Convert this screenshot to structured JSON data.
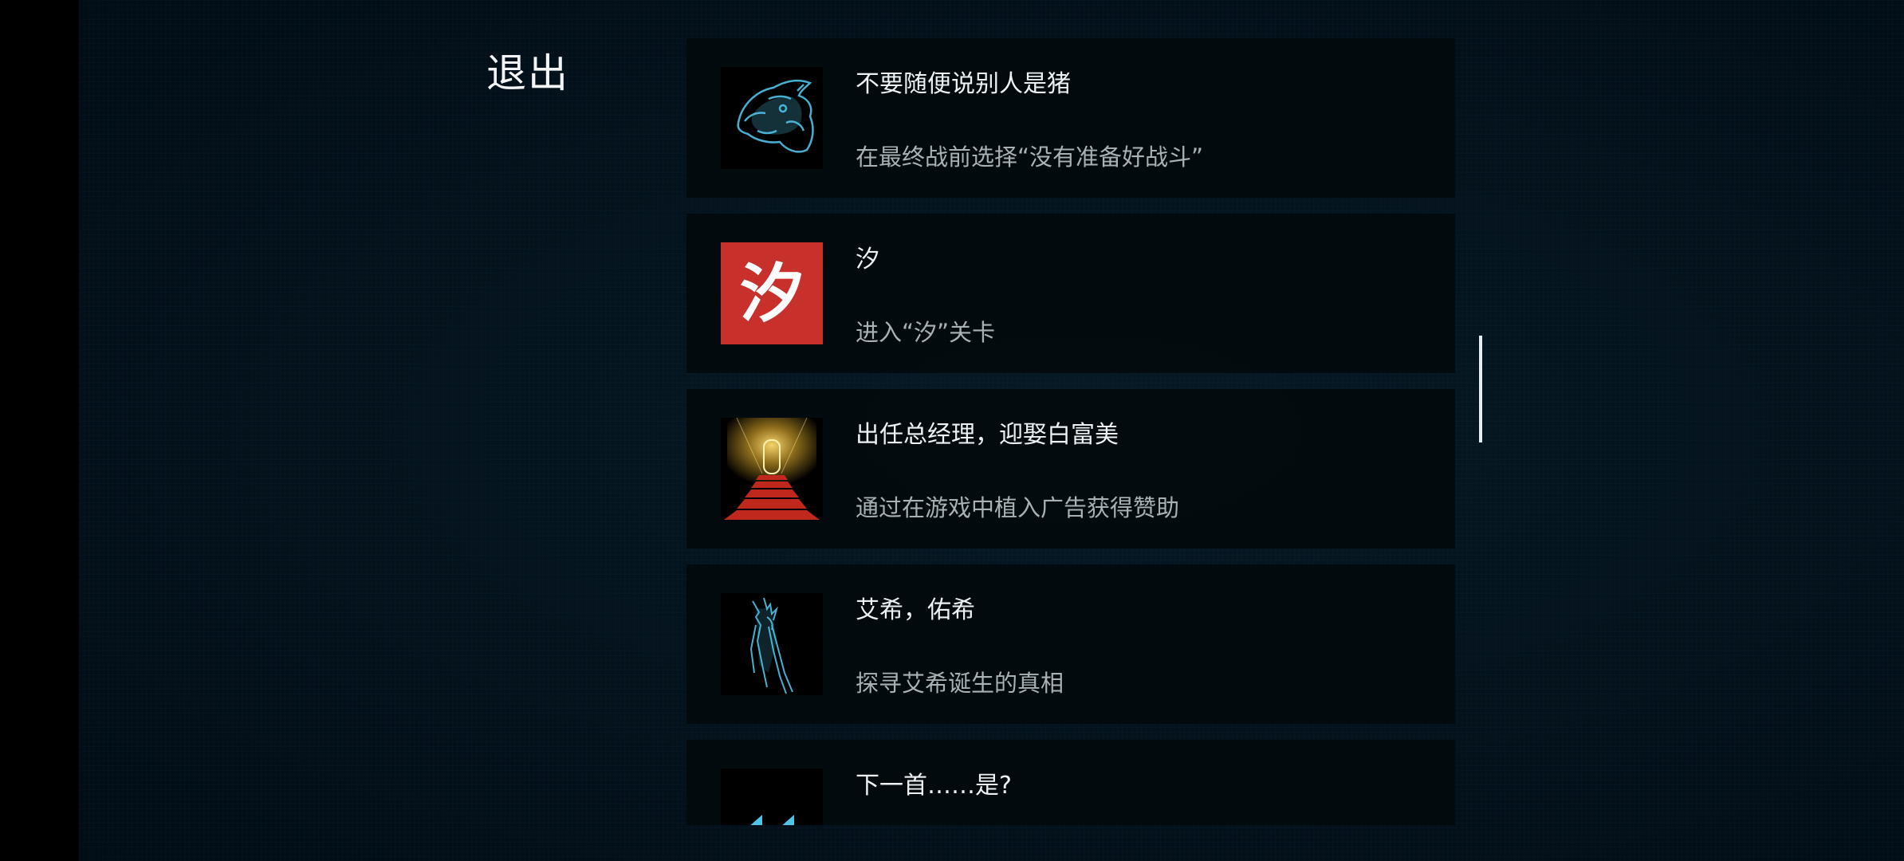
{
  "exit_label": "退出",
  "achievements": [
    {
      "icon": "blue-hologram-pig-icon",
      "title": "不要随便说别人是猪",
      "description": "在最终战前选择“没有准备好战斗”"
    },
    {
      "icon": "red-xi-character-icon",
      "icon_text": "汐",
      "title": "汐",
      "description": "进入“汐”关卡"
    },
    {
      "icon": "golden-corridor-red-stairs-icon",
      "title": "出任总经理，迎娶白富美",
      "description": "通过在游戏中植入广告获得赞助"
    },
    {
      "icon": "blue-sword-figure-icon",
      "title": "艾希，佑希",
      "description": "探寻艾希诞生的真相"
    },
    {
      "icon": "fast-forward-icon",
      "title": "下一首……是?",
      "description": ""
    }
  ],
  "colors": {
    "background": "#04131d",
    "card": "#03090d",
    "title_text": "#eef1f3",
    "desc_text": "#a9b1b6",
    "xi_icon_red": "#c8302c",
    "hologram_blue": "#4fc3e8"
  }
}
